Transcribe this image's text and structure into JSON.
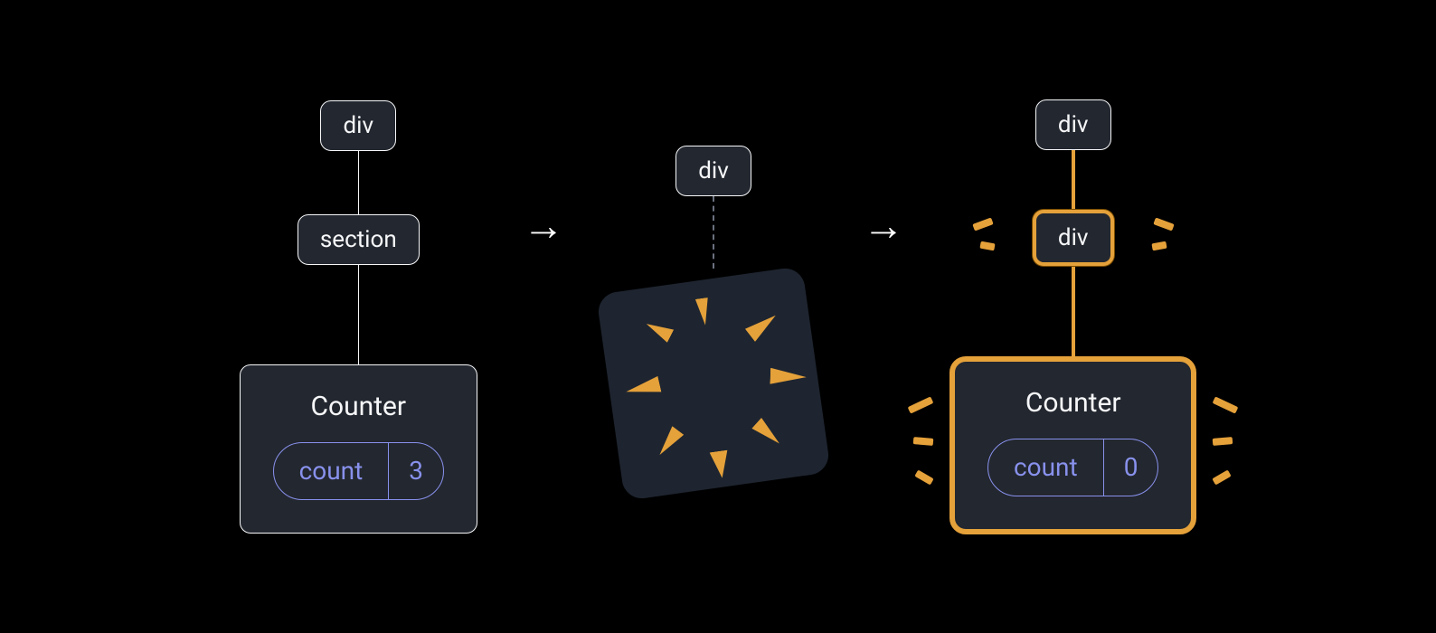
{
  "stage1": {
    "root": "div",
    "mid": "section",
    "counter_title": "Counter",
    "state_label": "count",
    "state_value": "3"
  },
  "stage2": {
    "root": "div"
  },
  "stage3": {
    "root": "div",
    "mid": "div",
    "counter_title": "Counter",
    "state_label": "count",
    "state_value": "0"
  }
}
